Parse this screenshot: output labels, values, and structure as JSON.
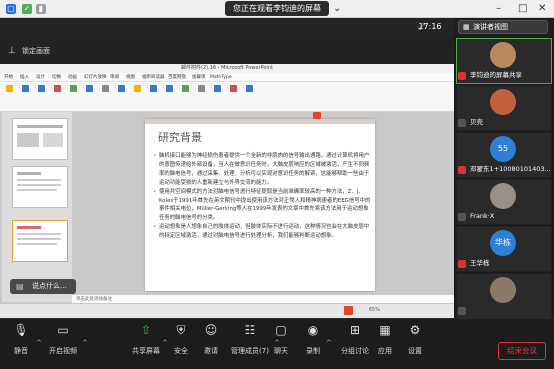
{
  "window": {
    "sharing_banner": "您正在观看李钧迪的屏幕",
    "time": "17:16",
    "view_button": "演讲者视图"
  },
  "lock": {
    "label": "锁定画面"
  },
  "ppt": {
    "title": "邮件附件(2).16 - Microsoft PowerPoint",
    "tabs": [
      "开始",
      "插入",
      "设计",
      "切换",
      "动画",
      "幻灯片放映",
      "审阅",
      "视图",
      "福昕阅读器",
      "百度网盘",
      "加载项",
      "MathType"
    ],
    "slide_title": "研究背景",
    "bullets": [
      "脑机接口能够为神经损伤患者提供一个全新的非肌肉的信号输出通路，通过计算机将用户的意图传递给外部设备，当人在做意识任务时，大脑皮层响应的区域被激活，产生不同频率的脑电信号，通过采集、处理、分析可以实现对意识任务的解读，这能够帮助一些由于运动功能受损的人重新建立与外界交流的能力。",
      "使用共空间模式的方法对脑电信号进行特征提取是当前准确率较高的一种方法，Z．J．Koles于1991年首先在英文期刊中提出使用该方法对正常人和精神病患者的EEG信号中的事件相关电位，Müller-Gerking等人在1999年发表的文章中首先将该方法用于运动想象任务的脑电信号的分类。",
      "运动想象是人想象自己的肢体运动，但肢体实际不进行运动，这种情况也会在大脑皮层中的特定区域激活，通过对脑电信号进行处理分析，我们能够判断运动想象。"
    ],
    "notes": "单击此处添加备注",
    "status_right": "65%"
  },
  "chat_overlay": {
    "label": "说点什么..."
  },
  "participants": [
    {
      "name": "李钧迪的屏幕共享",
      "avatar_color": "#b98a5e",
      "highlight": true,
      "mic": "mute"
    },
    {
      "name": "贝壳",
      "avatar_color": "#c0613f",
      "highlight": false,
      "mic": "on"
    },
    {
      "name": "邓翟东1+10080101403...",
      "avatar_text": "55",
      "avatar_color": "#2e7fd6",
      "highlight": false,
      "mic": "mute"
    },
    {
      "name": "Frank·X",
      "avatar_color": "#9a8f86",
      "highlight": false,
      "mic": "on"
    },
    {
      "name": "王华栋",
      "avatar_text": "华栋",
      "avatar_color": "#2e7fd6",
      "highlight": false,
      "mic": "mute"
    },
    {
      "name": "",
      "avatar_color": "#8a7a6a",
      "highlight": false,
      "mic": "on"
    }
  ],
  "toolbar": {
    "mute": "静音",
    "video": "开启视频",
    "share": "共享屏幕",
    "security": "安全",
    "invite": "邀请",
    "members": "管理成员(7)",
    "chat": "聊天",
    "record": "录制",
    "breakout": "分组讨论",
    "apps": "应用",
    "settings": "设置",
    "end": "结束会议"
  },
  "colors": {
    "end_red": "#dd3333",
    "accent_blue": "#2e7fd6",
    "mute_red": "#dd3333"
  }
}
